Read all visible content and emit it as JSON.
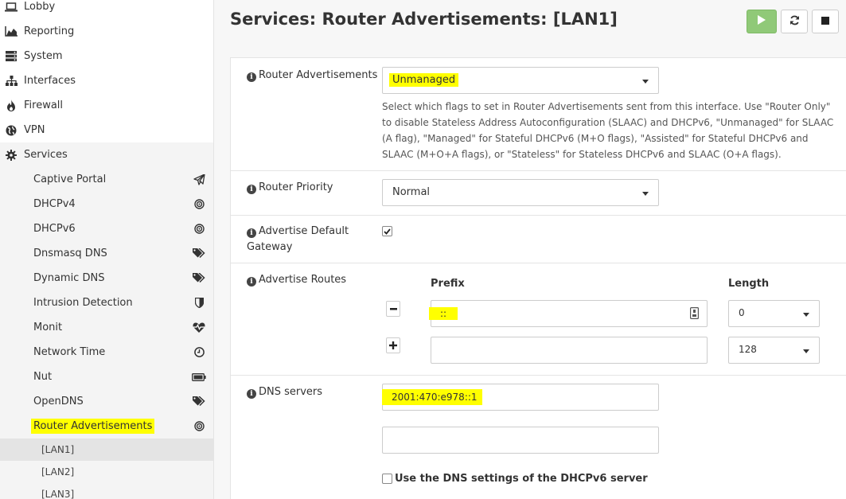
{
  "sidebar": {
    "top_items": [
      {
        "label": "Lobby",
        "icon": "laptop-icon"
      },
      {
        "label": "Reporting",
        "icon": "area-chart-icon"
      },
      {
        "label": "System",
        "icon": "server-icon"
      },
      {
        "label": "Interfaces",
        "icon": "sitemap-icon"
      },
      {
        "label": "Firewall",
        "icon": "fire-icon"
      },
      {
        "label": "VPN",
        "icon": "globe-icon"
      },
      {
        "label": "Services",
        "icon": "cog-icon"
      }
    ],
    "service_items": [
      {
        "label": "Captive Portal",
        "icon": "paper-plane-icon"
      },
      {
        "label": "DHCPv4",
        "icon": "bullseye-icon"
      },
      {
        "label": "DHCPv6",
        "icon": "bullseye-icon"
      },
      {
        "label": "Dnsmasq DNS",
        "icon": "tags-icon"
      },
      {
        "label": "Dynamic DNS",
        "icon": "tags-icon"
      },
      {
        "label": "Intrusion Detection",
        "icon": "shield-icon"
      },
      {
        "label": "Monit",
        "icon": "heartbeat-icon"
      },
      {
        "label": "Network Time",
        "icon": "clock-icon"
      },
      {
        "label": "Nut",
        "icon": "battery-icon"
      },
      {
        "label": "OpenDNS",
        "icon": "tags-icon"
      },
      {
        "label": "Router Advertisements",
        "icon": "bullseye-icon"
      }
    ],
    "ra_interfaces": [
      "[LAN1]",
      "[LAN2]",
      "[LAN3]"
    ]
  },
  "header": {
    "title": "Services: Router Advertisements: [LAN1]"
  },
  "form": {
    "router_advertisements": {
      "label": "Router Advertisements",
      "value": "Unmanaged",
      "help": "Select which flags to set in Router Advertisements sent from this interface. Use \"Router Only\" to disable Stateless Address Autoconfiguration (SLAAC) and DHCPv6, \"Unmanaged\" for SLAAC (A flag), \"Managed\" for Stateful DHCPv6 (M+O flags), \"Assisted\" for Stateful DHCPv6 and SLAAC (M+O+A flags), or \"Stateless\" for Stateless DHCPv6 and SLAAC (O+A flags)."
    },
    "router_priority": {
      "label": "Router Priority",
      "value": "Normal"
    },
    "advertise_default_gateway": {
      "label": "Advertise Default Gateway",
      "checked": true
    },
    "advertise_routes": {
      "label": "Advertise Routes",
      "prefix_header": "Prefix",
      "length_header": "Length",
      "rows": [
        {
          "prefix": "::",
          "length": "0"
        },
        {
          "prefix": "",
          "length": "128"
        }
      ]
    },
    "dns_servers": {
      "label": "DNS servers",
      "values": [
        "2001:470:e978::1",
        ""
      ],
      "use_dhcpv6_label": "Use the DNS settings of the DHCPv6 server",
      "use_dhcpv6_checked": false
    }
  },
  "colors": {
    "highlight": "#ffff00",
    "start_button": "#90c978",
    "sidebar_active": "#e4e4e4"
  }
}
